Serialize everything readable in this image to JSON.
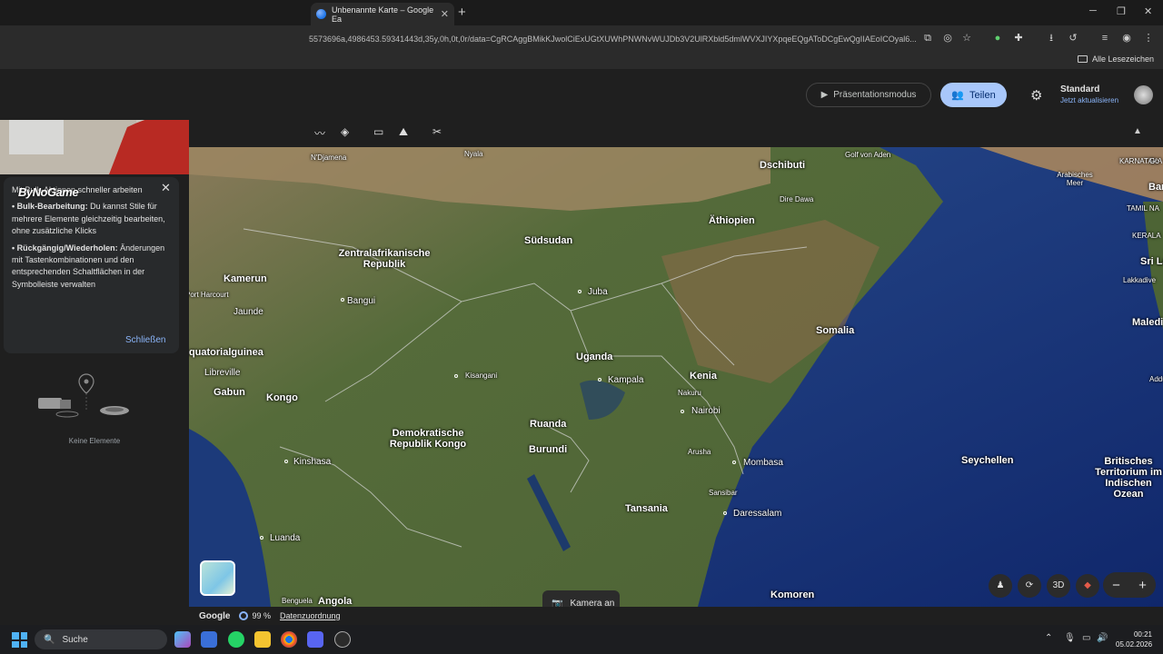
{
  "browser": {
    "tab_title": "Unbenannte Karte – Google Ea",
    "tab_close": "✕",
    "new_tab": "+",
    "url": "5573696a,4986453.59341443d,35y,0h,0t,0r/data=CgRCAggBMikKJwolCiExUGtXUWhPNWNvWUJDb3V2UlRXbld5dmlWVXJIYXpqeEQgAToDCgEwQgIIAEoICOyal6...",
    "all_bookmarks": "Alle Lesezeichen"
  },
  "header": {
    "presentation_mode": "Präsentationsmodus",
    "share": "Teilen",
    "plan_name": "Standard",
    "plan_cta": "Jetzt aktualisieren"
  },
  "tip": {
    "title": "Mit Bulk-Aktionen schneller arbeiten",
    "item1_bold": "• Bulk-Bearbeitung:",
    "item1_text": "Du kannst Stile für mehrere Elemente gleichzeitig bearbeiten, ohne zusätzliche Klicks",
    "item2_bold": "• Rückgängig/Wiederholen:",
    "item2_text": "Änderungen mit Tastenkombinationen und den entsprechenden Schaltflächen in der Symbolleiste verwalten",
    "close_action": "Schließen"
  },
  "watermark": "ByNoGame",
  "panel": {
    "empty_text": "Keine Elemente"
  },
  "map": {
    "labels_bold": [
      "Dschibuti",
      "Äthiopien",
      "Südsudan",
      "Zentralafrikanische Republik",
      "Kamerun",
      "Somalia",
      "Uganda",
      "Kenia",
      "Äquatorialguinea",
      "Gabun",
      "Kongo",
      "Ruanda",
      "Burundi",
      "Demokratische Republik Kongo",
      "Tansania",
      "Seychellen",
      "Britisches Territorium im Indischen Ozean",
      "Malediven",
      "Komoren",
      "Angola",
      "Sri La",
      "Bar"
    ],
    "labels_city": [
      "N'Djamena",
      "Jaunde",
      "Bangui",
      "Juba",
      "Libreville",
      "Kisangani",
      "Kampala",
      "Nakuru",
      "Nairobi",
      "Arusha",
      "Mombasa",
      "Sansibar",
      "Daressalam",
      "Kinshasa",
      "Luanda",
      "Benguela",
      "Port Harcourt",
      "Golf von Aden",
      "Arabisches Meer",
      "Dire Dawa",
      "Nyala",
      "KARNATAKA",
      "TAMIL NA",
      "KERALA",
      "Lakkadive",
      "Addu",
      "Go"
    ],
    "camera_label": "Kamera an",
    "view_3d": "3D",
    "zoom_out": "−",
    "zoom_in": "+"
  },
  "bottombar": {
    "brand": "Google",
    "progress": "99 %",
    "attribution": "Datenzuordnung"
  },
  "taskbar": {
    "search": "Suche",
    "time": "00:21",
    "date": "05.02.2026"
  },
  "colors": {
    "accent": "#a8c7fa",
    "link": "#8ab4f8",
    "panel_bg": "#1f1f1f",
    "card_bg": "#282a2c"
  }
}
